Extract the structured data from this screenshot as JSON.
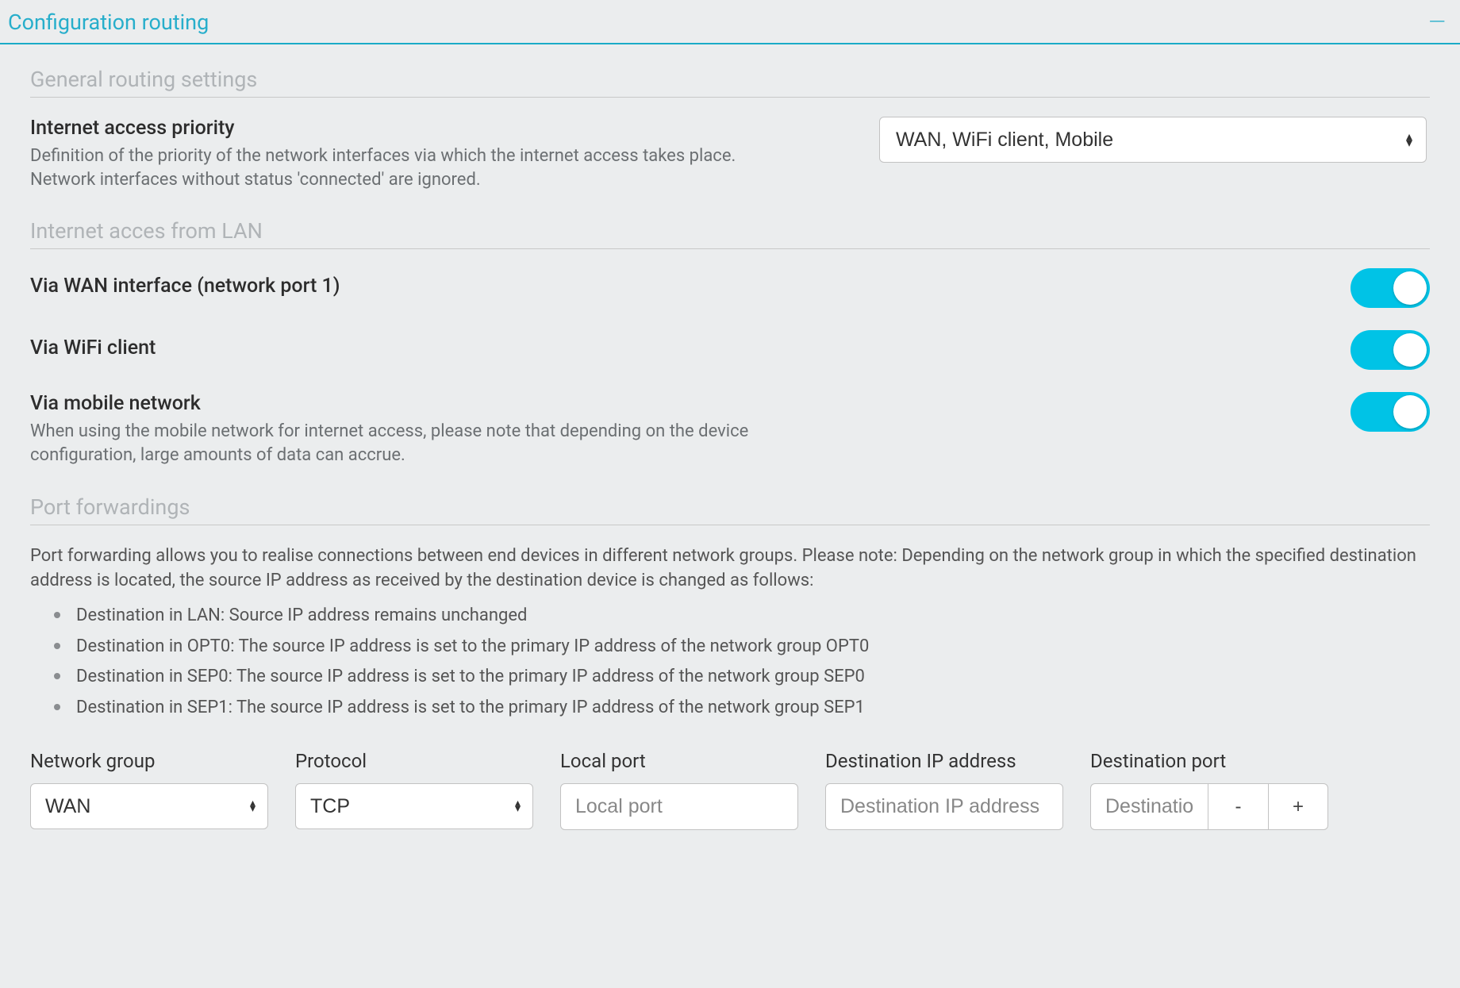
{
  "panel": {
    "title": "Configuration routing"
  },
  "sections": {
    "general": {
      "heading": "General routing settings",
      "priority": {
        "label": "Internet access priority",
        "help": "Definition of the priority of the network interfaces via which the internet access takes place. Network interfaces without status 'connected' are ignored.",
        "value": "WAN, WiFi client, Mobile"
      }
    },
    "lan_access": {
      "heading": "Internet acces from LAN",
      "items": {
        "wan": {
          "label": "Via WAN interface (network port 1)",
          "enabled": true
        },
        "wifi": {
          "label": "Via WiFi client",
          "enabled": true
        },
        "mobile": {
          "label": "Via mobile network",
          "help": "When using the mobile network for internet access, please note that depending on the device configuration, large amounts of data can accrue.",
          "enabled": true
        }
      }
    },
    "port_forwarding": {
      "heading": "Port forwardings",
      "description": "Port forwarding allows you to realise connections between end devices in different network groups. Please note: Depending on the network group in which the specified destination address is located, the source IP address as received by the destination device is changed as follows:",
      "notes": [
        "Destination in LAN: Source IP address remains unchanged",
        "Destination in OPT0: The source IP address is set to the primary IP address of the network group OPT0",
        "Destination in SEP0: The source IP address is set to the primary IP address of the network group SEP0",
        "Destination in SEP1: The source IP address is set to the primary IP address of the network group SEP1"
      ],
      "form": {
        "network_group": {
          "label": "Network group",
          "value": "WAN"
        },
        "protocol": {
          "label": "Protocol",
          "value": "TCP"
        },
        "local_port": {
          "label": "Local port",
          "placeholder": "Local port",
          "value": ""
        },
        "dest_ip": {
          "label": "Destination IP address",
          "placeholder": "Destination IP address",
          "value": ""
        },
        "dest_port": {
          "label": "Destination port",
          "placeholder": "Destination port",
          "value": "",
          "minus": "-",
          "plus": "+"
        }
      }
    }
  }
}
